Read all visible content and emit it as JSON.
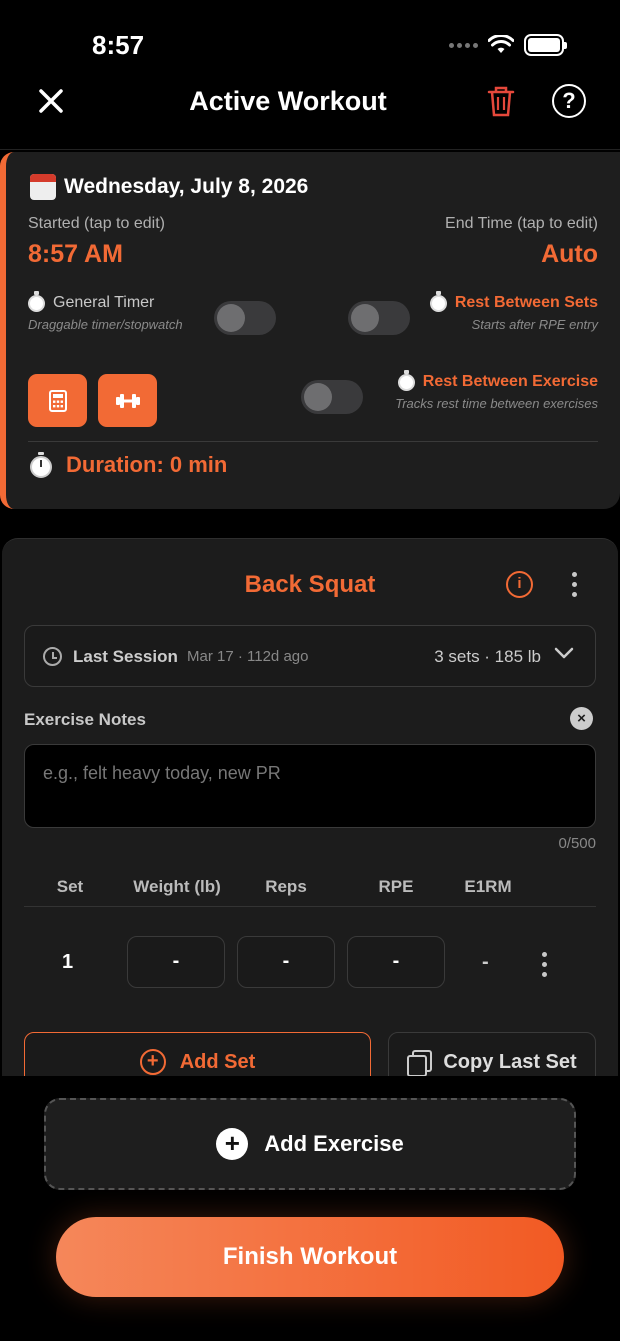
{
  "status_bar": {
    "time": "8:57"
  },
  "nav": {
    "title": "Active Workout",
    "help_glyph": "?"
  },
  "session": {
    "date": "Wednesday, July 8, 2026",
    "started_label": "Started (tap to edit)",
    "started_value": "8:57 AM",
    "end_label": "End Time (tap to edit)",
    "end_value": "Auto",
    "general_timer_label": "General Timer",
    "general_timer_sub": "Draggable timer/stopwatch",
    "rest_sets_label": "Rest Between Sets",
    "rest_sets_sub": "Starts after RPE entry",
    "rest_exercise_label": "Rest Between Exercise",
    "rest_exercise_sub": "Tracks rest time between exercises",
    "duration": "Duration: 0 min",
    "toggles": {
      "general_timer": false,
      "rest_between_sets": false,
      "rest_between_exercise": false
    }
  },
  "exercise": {
    "name": "Back Squat",
    "info_glyph": "i",
    "last_session": {
      "label": "Last Session",
      "date": "Mar 17 · 112d ago",
      "summary": "3 sets · 185 lb"
    },
    "notes": {
      "label": "Exercise Notes",
      "clear_glyph": "×",
      "placeholder": "e.g., felt heavy today, new PR",
      "counter": "0/500"
    },
    "table": {
      "headers": [
        "Set",
        "Weight (lb)",
        "Reps",
        "RPE",
        "E1RM"
      ],
      "rows": [
        {
          "set": "1",
          "weight": "-",
          "reps": "-",
          "rpe": "-",
          "e1rm": "-"
        }
      ]
    },
    "add_set_label": "Add Set",
    "copy_last_set_label": "Copy Last Set"
  },
  "actions": {
    "add_exercise_label": "Add Exercise",
    "finish_label": "Finish Workout"
  },
  "colors": {
    "accent": "#f26a35",
    "background": "#000000",
    "card": "#1e1e1e",
    "trash": "#e5483b"
  }
}
